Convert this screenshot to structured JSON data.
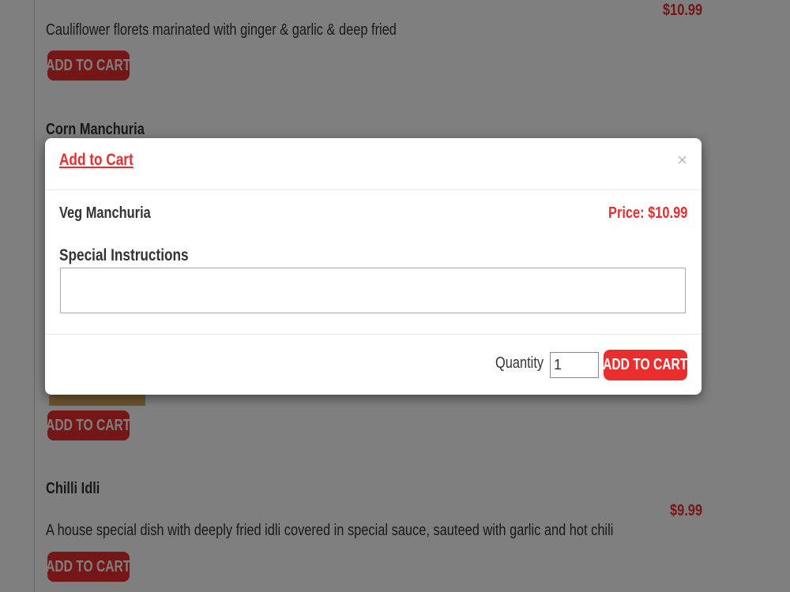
{
  "menu": {
    "items": [
      {
        "description": "Cauliflower florets marinated with ginger & garlic & deep fried",
        "price": "$10.99",
        "button_label": "ADD TO CART"
      },
      {
        "title": "Corn Manchuria"
      },
      {
        "button_label": "ADD TO CART"
      },
      {
        "title": "Chilli Idli",
        "price": "$9.99",
        "description": "A house special dish with deeply fried idli covered in special sauce, sauteed with garlic and hot chili",
        "button_label": "ADD TO CART"
      }
    ]
  },
  "modal": {
    "title": "Add to Cart",
    "close_symbol": "×",
    "item_name": "Veg Manchuria",
    "price_text": "Price: $10.99",
    "instructions_label": "Special Instructions",
    "instructions_value": "",
    "quantity_label": "Quantity",
    "quantity_value": "1",
    "add_button_label": "ADD TO CART"
  },
  "colors": {
    "accent": "#ea2e2e",
    "text": "#333333",
    "overlay": "rgba(0,0,0,0.5)"
  }
}
